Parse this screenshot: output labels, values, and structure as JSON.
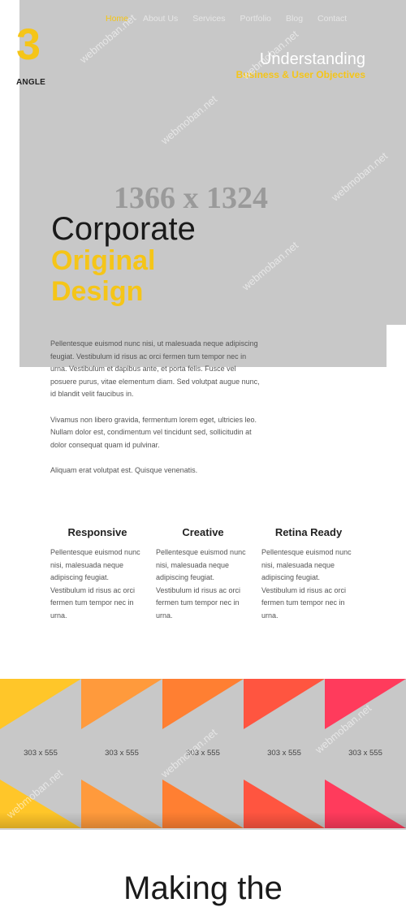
{
  "nav": {
    "items": [
      {
        "label": "Home",
        "active": true
      },
      {
        "label": "About Us",
        "active": false
      },
      {
        "label": "Services",
        "active": false
      },
      {
        "label": "Portfolio",
        "active": false
      },
      {
        "label": "Blog",
        "active": false
      },
      {
        "label": "Contact",
        "active": false
      }
    ]
  },
  "logo": {
    "number": "3",
    "word": "ANGLE"
  },
  "hero": {
    "title": "Understanding",
    "subtitle": "Business & User Objectives",
    "placeholder_size": "1366 x 1324",
    "headline_line1": "Corporate",
    "headline_line2": "Original",
    "headline_line3": "Design"
  },
  "intro": {
    "p1": "Pellentesque euismod nunc nisi, ut malesuada neque adipiscing feugiat. Vestibulum id risus ac orci fermen tum tempor nec in urna. Vestibulum et dapibus ante, et porta felis. Fusce vel posuere purus, vitae elementum diam. Sed volutpat augue nunc, id blandit velit faucibus in.",
    "p2": "Vivamus non libero gravida, fermentum lorem eget, ultricies leo. Nullam dolor est, condimentum vel tincidunt sed, sollicitudin at dolor consequat quam id pulvinar.",
    "p3": "Aliquam erat volutpat est. Quisque venenatis."
  },
  "features": [
    {
      "title": "Responsive",
      "text": "Pellentesque euismod nunc nisi, malesuada neque adipiscing feugiat. Vestibulum id risus ac orci fermen tum tempor nec in urna."
    },
    {
      "title": "Creative",
      "text": "Pellentesque euismod nunc nisi, malesuada neque adipiscing feugiat. Vestibulum id risus ac orci fermen tum tempor nec in urna."
    },
    {
      "title": "Retina Ready",
      "text": "Pellentesque euismod nunc nisi, malesuada neque adipiscing feugiat. Vestibulum id risus ac orci fermen tum tempor nec in urna."
    }
  ],
  "gallery": {
    "tiles": [
      {
        "size": "303 x 555",
        "color": "#ffc629"
      },
      {
        "size": "303 x 555",
        "color": "#ff9a3c"
      },
      {
        "size": "303 x 555",
        "color": "#ff7f32"
      },
      {
        "size": "303 x 555",
        "color": "#ff5540"
      },
      {
        "size": "303 x 555",
        "color": "#ff3b5c"
      }
    ]
  },
  "bottom": {
    "heading": "Making the"
  },
  "watermark": "webmoban.net",
  "colors": {
    "accent": "#f5c518",
    "placeholder_bg": "#c8c8c8"
  }
}
